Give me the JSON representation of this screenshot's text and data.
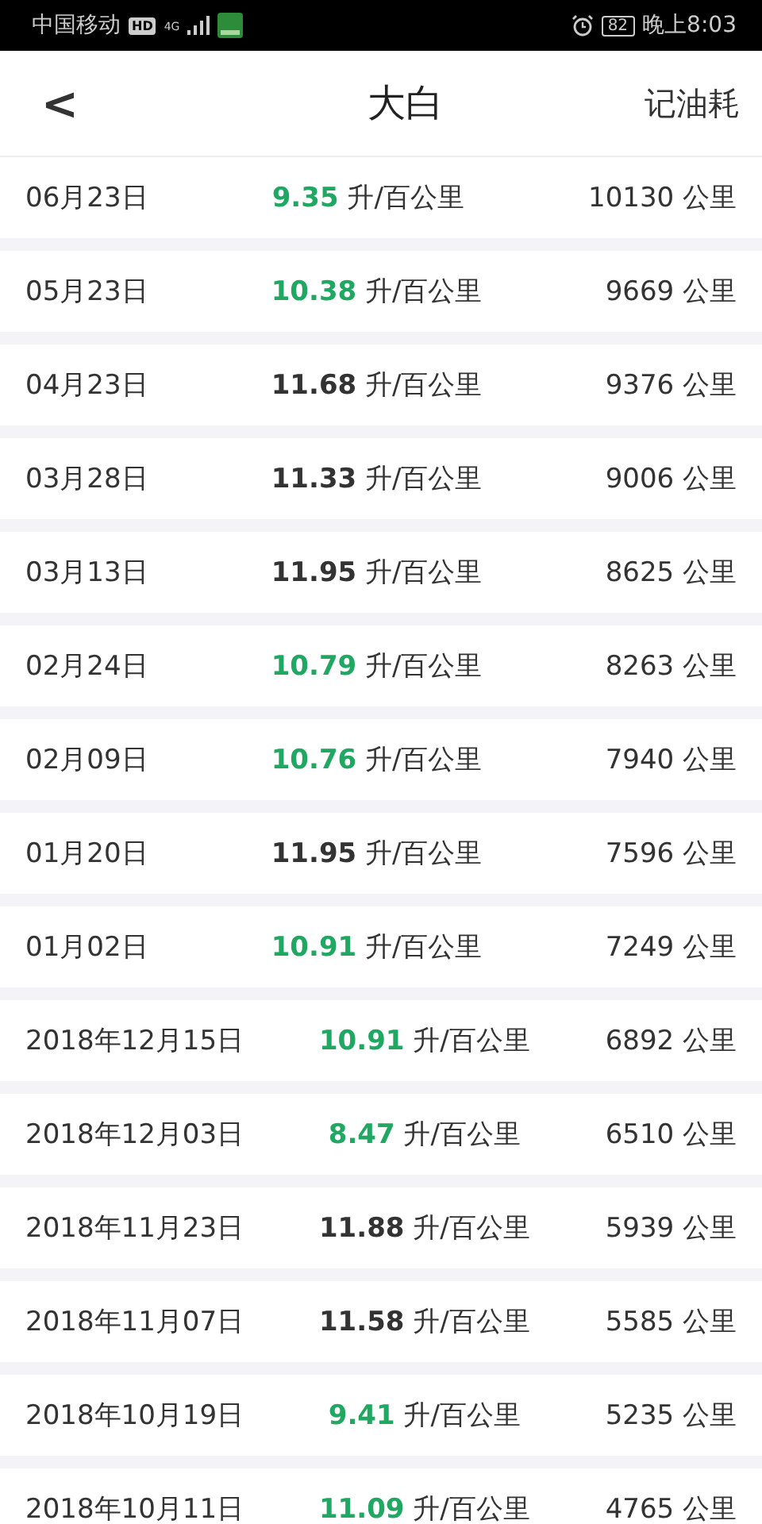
{
  "status_bar": {
    "carrier": "中国移动",
    "network_badge": "HD",
    "network_type": "4G",
    "battery": "82",
    "time": "晚上8:03"
  },
  "header": {
    "back": "<",
    "title": "大白",
    "action": "记油耗"
  },
  "records": [
    {
      "date": "06月23日",
      "consumption": "9.35",
      "unit": "升/百公里",
      "below_average": true,
      "odometer": "10130 公里"
    },
    {
      "date": "05月23日",
      "consumption": "10.38",
      "unit": "升/百公里",
      "below_average": true,
      "odometer": "9669 公里"
    },
    {
      "date": "04月23日",
      "consumption": "11.68",
      "unit": "升/百公里",
      "below_average": false,
      "odometer": "9376 公里"
    },
    {
      "date": "03月28日",
      "consumption": "11.33",
      "unit": "升/百公里",
      "below_average": false,
      "odometer": "9006 公里"
    },
    {
      "date": "03月13日",
      "consumption": "11.95",
      "unit": "升/百公里",
      "below_average": false,
      "odometer": "8625 公里"
    },
    {
      "date": "02月24日",
      "consumption": "10.79",
      "unit": "升/百公里",
      "below_average": true,
      "odometer": "8263 公里"
    },
    {
      "date": "02月09日",
      "consumption": "10.76",
      "unit": "升/百公里",
      "below_average": true,
      "odometer": "7940 公里"
    },
    {
      "date": "01月20日",
      "consumption": "11.95",
      "unit": "升/百公里",
      "below_average": false,
      "odometer": "7596 公里"
    },
    {
      "date": "01月02日",
      "consumption": "10.91",
      "unit": "升/百公里",
      "below_average": true,
      "odometer": "7249 公里"
    },
    {
      "date": "2018年12月15日",
      "consumption": "10.91",
      "unit": "升/百公里",
      "below_average": true,
      "odometer": "6892 公里"
    },
    {
      "date": "2018年12月03日",
      "consumption": "8.47",
      "unit": "升/百公里",
      "below_average": true,
      "odometer": "6510 公里"
    },
    {
      "date": "2018年11月23日",
      "consumption": "11.88",
      "unit": "升/百公里",
      "below_average": false,
      "odometer": "5939 公里"
    },
    {
      "date": "2018年11月07日",
      "consumption": "11.58",
      "unit": "升/百公里",
      "below_average": false,
      "odometer": "5585 公里"
    },
    {
      "date": "2018年10月19日",
      "consumption": "9.41",
      "unit": "升/百公里",
      "below_average": true,
      "odometer": "5235 公里"
    },
    {
      "date": "2018年10月11日",
      "consumption": "11.09",
      "unit": "升/百公里",
      "below_average": true,
      "odometer": "4765 公里"
    }
  ]
}
